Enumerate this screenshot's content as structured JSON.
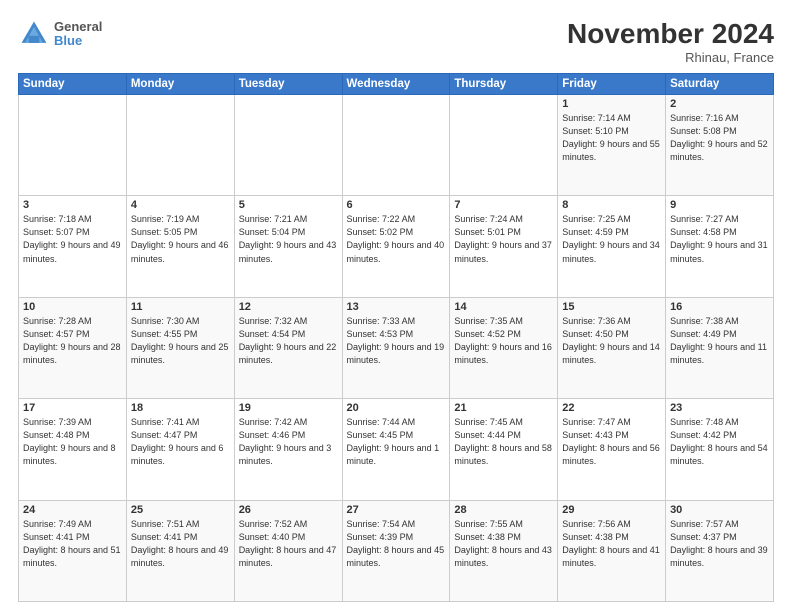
{
  "header": {
    "logo_line1": "General",
    "logo_line2": "Blue",
    "month": "November 2024",
    "location": "Rhinau, France"
  },
  "weekdays": [
    "Sunday",
    "Monday",
    "Tuesday",
    "Wednesday",
    "Thursday",
    "Friday",
    "Saturday"
  ],
  "weeks": [
    [
      {
        "day": "",
        "info": ""
      },
      {
        "day": "",
        "info": ""
      },
      {
        "day": "",
        "info": ""
      },
      {
        "day": "",
        "info": ""
      },
      {
        "day": "",
        "info": ""
      },
      {
        "day": "1",
        "info": "Sunrise: 7:14 AM\nSunset: 5:10 PM\nDaylight: 9 hours\nand 55 minutes."
      },
      {
        "day": "2",
        "info": "Sunrise: 7:16 AM\nSunset: 5:08 PM\nDaylight: 9 hours\nand 52 minutes."
      }
    ],
    [
      {
        "day": "3",
        "info": "Sunrise: 7:18 AM\nSunset: 5:07 PM\nDaylight: 9 hours\nand 49 minutes."
      },
      {
        "day": "4",
        "info": "Sunrise: 7:19 AM\nSunset: 5:05 PM\nDaylight: 9 hours\nand 46 minutes."
      },
      {
        "day": "5",
        "info": "Sunrise: 7:21 AM\nSunset: 5:04 PM\nDaylight: 9 hours\nand 43 minutes."
      },
      {
        "day": "6",
        "info": "Sunrise: 7:22 AM\nSunset: 5:02 PM\nDaylight: 9 hours\nand 40 minutes."
      },
      {
        "day": "7",
        "info": "Sunrise: 7:24 AM\nSunset: 5:01 PM\nDaylight: 9 hours\nand 37 minutes."
      },
      {
        "day": "8",
        "info": "Sunrise: 7:25 AM\nSunset: 4:59 PM\nDaylight: 9 hours\nand 34 minutes."
      },
      {
        "day": "9",
        "info": "Sunrise: 7:27 AM\nSunset: 4:58 PM\nDaylight: 9 hours\nand 31 minutes."
      }
    ],
    [
      {
        "day": "10",
        "info": "Sunrise: 7:28 AM\nSunset: 4:57 PM\nDaylight: 9 hours\nand 28 minutes."
      },
      {
        "day": "11",
        "info": "Sunrise: 7:30 AM\nSunset: 4:55 PM\nDaylight: 9 hours\nand 25 minutes."
      },
      {
        "day": "12",
        "info": "Sunrise: 7:32 AM\nSunset: 4:54 PM\nDaylight: 9 hours\nand 22 minutes."
      },
      {
        "day": "13",
        "info": "Sunrise: 7:33 AM\nSunset: 4:53 PM\nDaylight: 9 hours\nand 19 minutes."
      },
      {
        "day": "14",
        "info": "Sunrise: 7:35 AM\nSunset: 4:52 PM\nDaylight: 9 hours\nand 16 minutes."
      },
      {
        "day": "15",
        "info": "Sunrise: 7:36 AM\nSunset: 4:50 PM\nDaylight: 9 hours\nand 14 minutes."
      },
      {
        "day": "16",
        "info": "Sunrise: 7:38 AM\nSunset: 4:49 PM\nDaylight: 9 hours\nand 11 minutes."
      }
    ],
    [
      {
        "day": "17",
        "info": "Sunrise: 7:39 AM\nSunset: 4:48 PM\nDaylight: 9 hours\nand 8 minutes."
      },
      {
        "day": "18",
        "info": "Sunrise: 7:41 AM\nSunset: 4:47 PM\nDaylight: 9 hours\nand 6 minutes."
      },
      {
        "day": "19",
        "info": "Sunrise: 7:42 AM\nSunset: 4:46 PM\nDaylight: 9 hours\nand 3 minutes."
      },
      {
        "day": "20",
        "info": "Sunrise: 7:44 AM\nSunset: 4:45 PM\nDaylight: 9 hours\nand 1 minute."
      },
      {
        "day": "21",
        "info": "Sunrise: 7:45 AM\nSunset: 4:44 PM\nDaylight: 8 hours\nand 58 minutes."
      },
      {
        "day": "22",
        "info": "Sunrise: 7:47 AM\nSunset: 4:43 PM\nDaylight: 8 hours\nand 56 minutes."
      },
      {
        "day": "23",
        "info": "Sunrise: 7:48 AM\nSunset: 4:42 PM\nDaylight: 8 hours\nand 54 minutes."
      }
    ],
    [
      {
        "day": "24",
        "info": "Sunrise: 7:49 AM\nSunset: 4:41 PM\nDaylight: 8 hours\nand 51 minutes."
      },
      {
        "day": "25",
        "info": "Sunrise: 7:51 AM\nSunset: 4:41 PM\nDaylight: 8 hours\nand 49 minutes."
      },
      {
        "day": "26",
        "info": "Sunrise: 7:52 AM\nSunset: 4:40 PM\nDaylight: 8 hours\nand 47 minutes."
      },
      {
        "day": "27",
        "info": "Sunrise: 7:54 AM\nSunset: 4:39 PM\nDaylight: 8 hours\nand 45 minutes."
      },
      {
        "day": "28",
        "info": "Sunrise: 7:55 AM\nSunset: 4:38 PM\nDaylight: 8 hours\nand 43 minutes."
      },
      {
        "day": "29",
        "info": "Sunrise: 7:56 AM\nSunset: 4:38 PM\nDaylight: 8 hours\nand 41 minutes."
      },
      {
        "day": "30",
        "info": "Sunrise: 7:57 AM\nSunset: 4:37 PM\nDaylight: 8 hours\nand 39 minutes."
      }
    ]
  ]
}
